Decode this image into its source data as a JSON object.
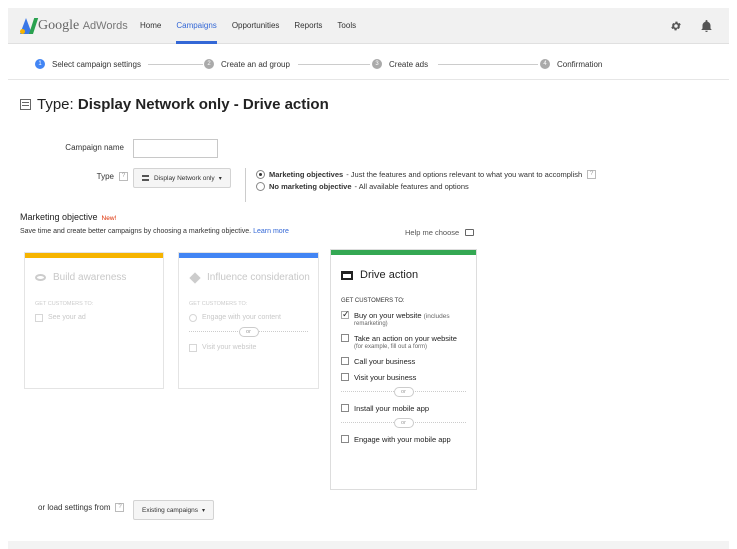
{
  "header": {
    "brand_google": "Google",
    "brand_product": "AdWords",
    "nav": [
      {
        "label": "Home"
      },
      {
        "label": "Campaigns"
      },
      {
        "label": "Opportunities"
      },
      {
        "label": "Reports"
      },
      {
        "label": "Tools"
      }
    ],
    "active_nav": "Campaigns"
  },
  "stepper": {
    "steps": [
      {
        "num": "1",
        "label": "Select campaign settings"
      },
      {
        "num": "2",
        "label": "Create an ad group"
      },
      {
        "num": "3",
        "label": "Create ads"
      },
      {
        "num": "4",
        "label": "Confirmation"
      }
    ]
  },
  "page": {
    "heading_prefix": "Type:",
    "heading_bold": "Display Network only - Drive action"
  },
  "form": {
    "campaign_name_label": "Campaign name",
    "campaign_name_value": "",
    "type_label": "Type",
    "help_glyph": "?",
    "type_value": "Display Network only",
    "caret": "▾",
    "radio_marketing_bold": "Marketing objectives",
    "radio_marketing_rest": "- Just the features and options relevant to what you want to accomplish",
    "radio_none_bold": "No marketing objective",
    "radio_none_rest": "- All available features and options"
  },
  "objective": {
    "title": "Marketing objective",
    "new_badge": "New!",
    "desc": "Save time and create better campaigns by choosing a marketing objective.",
    "learn_more": "Learn more",
    "help_me_choose": "Help me choose"
  },
  "cards": {
    "awareness": {
      "title": "Build awareness",
      "sub": "GET CUSTOMERS TO:",
      "opt1": "See your ad"
    },
    "influence": {
      "title": "Influence consideration",
      "sub": "GET CUSTOMERS TO:",
      "opt1": "Engage with your content",
      "or": "or",
      "opt2": "Visit your website"
    },
    "action": {
      "title": "Drive action",
      "sub": "GET CUSTOMERS TO:",
      "opt1": "Buy on your website",
      "opt1_suffix": "(includes",
      "opt1_small": "remarketing)",
      "opt2": "Take an action on your website",
      "opt2_small": "(for example, fill out a form)",
      "opt3": "Call your business",
      "opt4": "Visit your business",
      "or": "or",
      "opt5": "Install your mobile app",
      "opt6": "Engage with your mobile app"
    }
  },
  "load": {
    "label": "or load settings from",
    "button": "Existing campaigns"
  },
  "colors": {
    "awareness": "#f6b400",
    "influence": "#4285f4",
    "action": "#34a853"
  }
}
